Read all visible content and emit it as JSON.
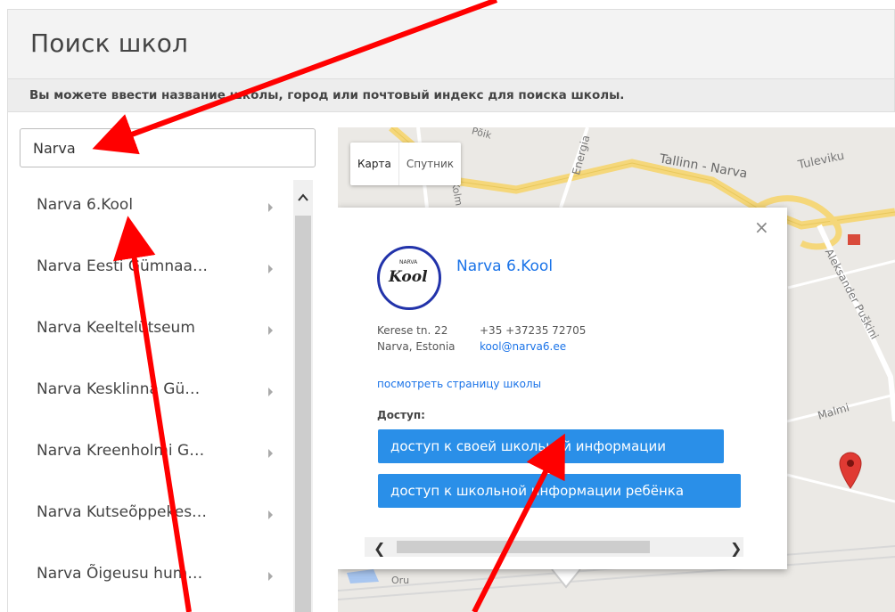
{
  "header": {
    "title": "Поиск школ",
    "subtitle": "Вы можете ввести название школы, город или почтовый индекс для поиска школы."
  },
  "search": {
    "value": "Narva"
  },
  "schools": [
    {
      "label": "Narva 6.Kool"
    },
    {
      "label": "Narva Eesti Gümnaa…"
    },
    {
      "label": "Narva Keeltelütseum"
    },
    {
      "label": "Narva Kesklinna Gü…"
    },
    {
      "label": "Narva Kreenholmi G…"
    },
    {
      "label": "Narva Kutseõppekes…"
    },
    {
      "label": "Narva Õigeusu hum…"
    }
  ],
  "map": {
    "type_map": "Карта",
    "type_satellite": "Спутник",
    "labels": [
      "Tallinn - Narva",
      "Tuleviku",
      "Aleksander Puškini",
      "Malmi",
      "Energia",
      "Oru",
      "Põik",
      "Kolm"
    ]
  },
  "popup": {
    "logo_text": "Kool",
    "logo_small": "NARVA",
    "name": "Narva 6.Kool",
    "address_line1": "Kerese tn. 22",
    "address_line2": "Narva, Estonia",
    "phone": "+35 +37235 72705",
    "email": "kool@narva6.ee",
    "page_link": "посмотреть страницу школы",
    "access_label": "Доступ:",
    "button_own": "доступ к своей школьной информации",
    "button_child": "доступ к школьной информации ребёнка"
  },
  "colors": {
    "accent": "#2a8fe8",
    "link": "#1a73e8",
    "annotation": "#ff0000"
  }
}
